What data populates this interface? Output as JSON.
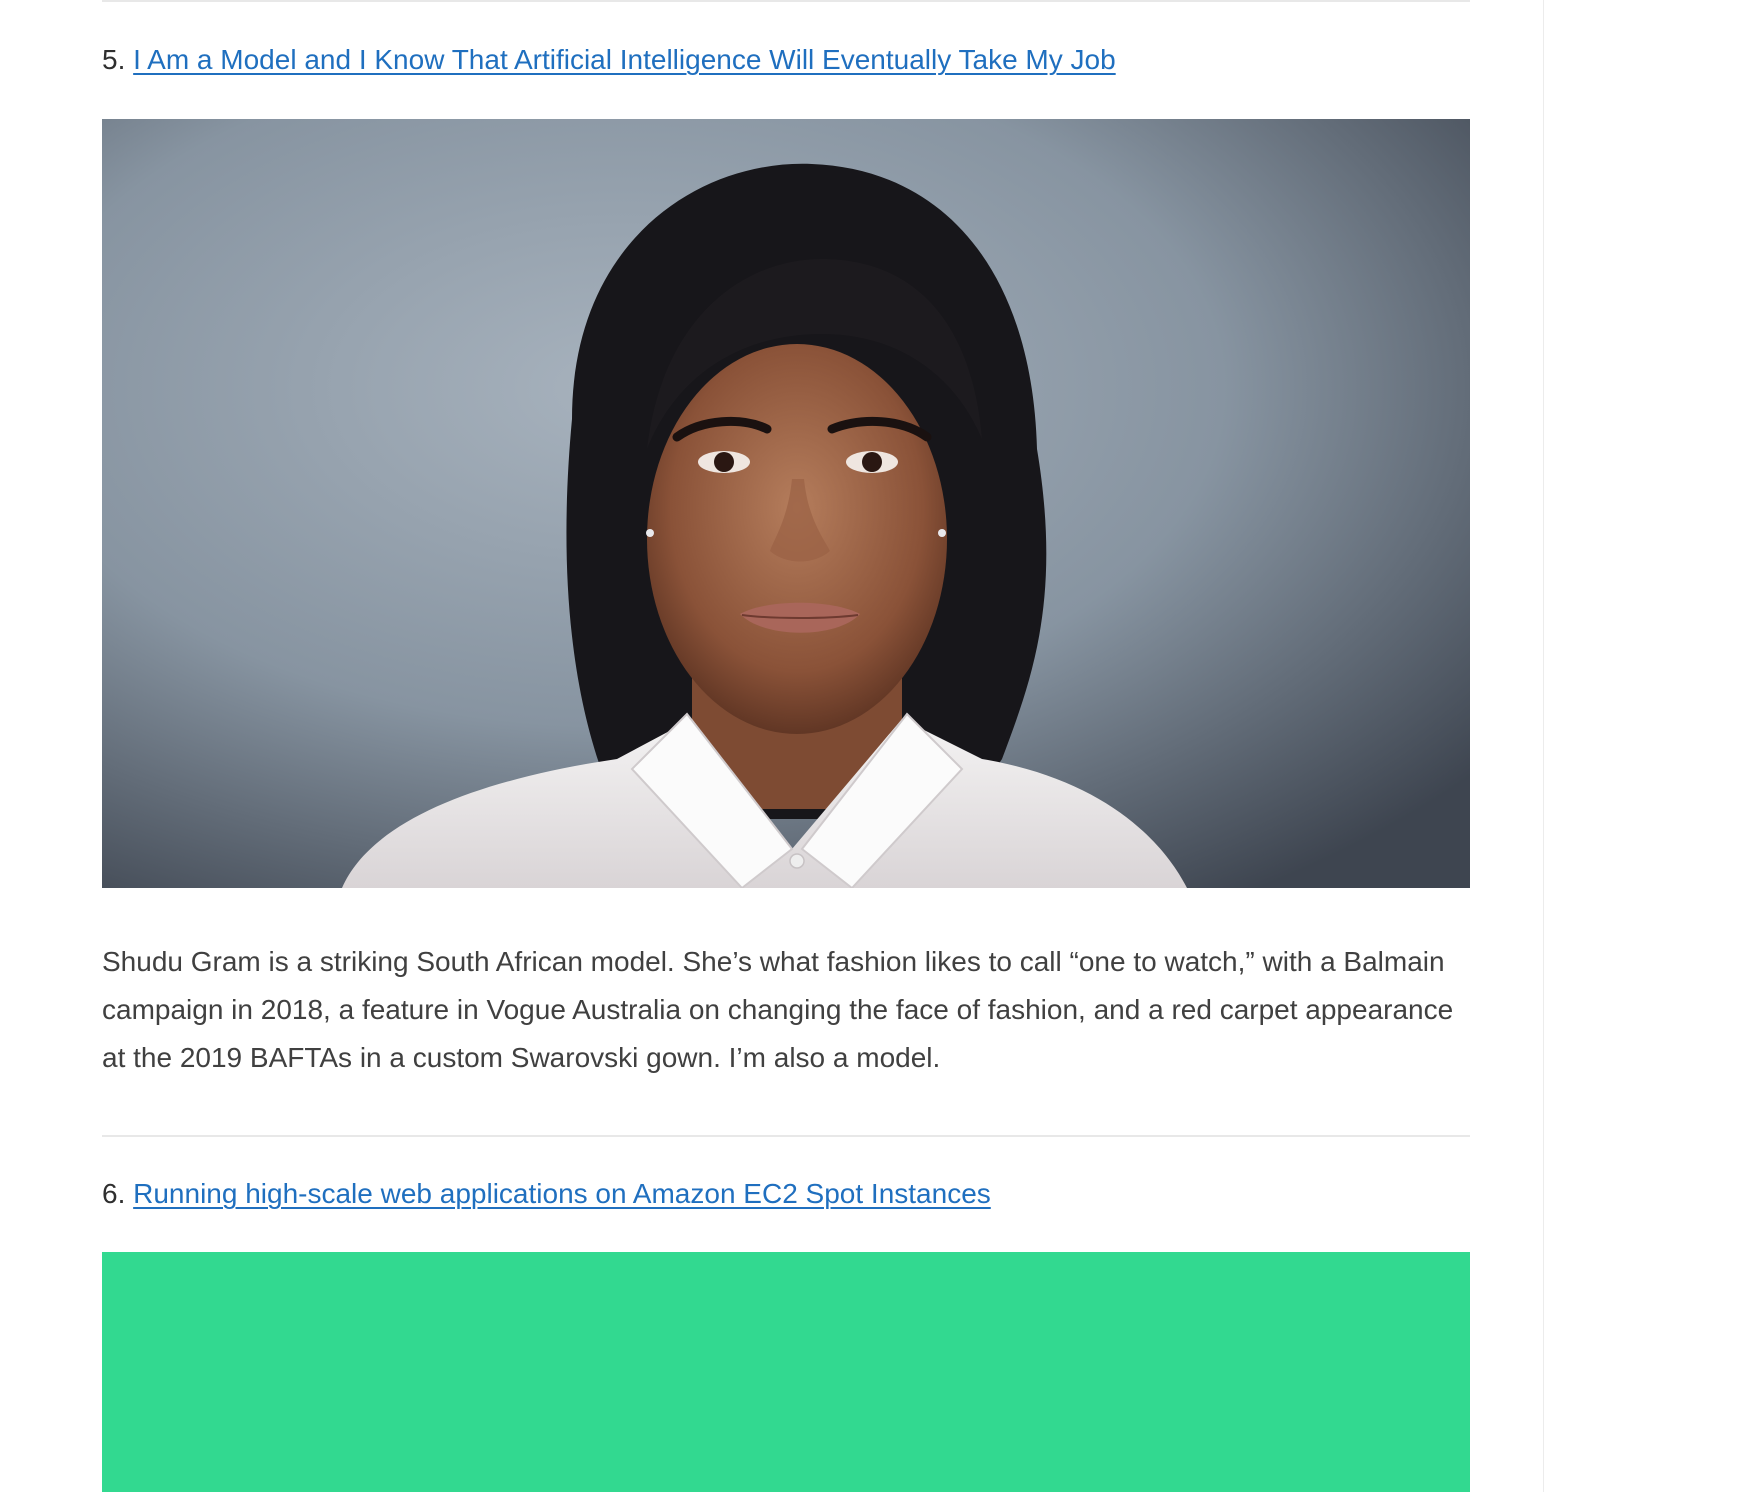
{
  "items": [
    {
      "number": "5.",
      "link_text": "I Am a Model and I Know That Artificial Intelligence Will Eventually Take My Job",
      "image_alt": "portrait-photo",
      "paragraph": "Shudu Gram is a striking South African model. She’s what fashion likes to call “one to watch,” with a Balmain campaign in 2018, a feature in Vogue Australia on changing the face of fashion, and a red carpet appearance at the 2019 BAFTAs in a custom Swarovski gown. I’m also a model."
    },
    {
      "number": "6.",
      "link_text": "Running high-scale web applications on Amazon EC2 Spot Instances"
    }
  ],
  "colors": {
    "link": "#1f6fbf",
    "banner": "#32d990",
    "photo_background": "#8e9aa6"
  }
}
